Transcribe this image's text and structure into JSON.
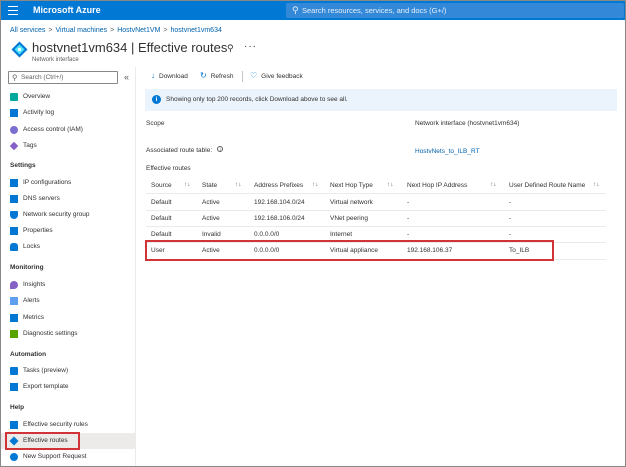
{
  "topbar": {
    "brand": "Microsoft Azure",
    "search_placeholder": "Search resources, services, and docs (G+/)"
  },
  "breadcrumb": [
    "All services",
    "Virtual machines",
    "HostvNet1VM",
    "hostvnet1vm634"
  ],
  "header": {
    "title": "hostvnet1vm634 | Effective routes",
    "subtitle": "Network interface"
  },
  "sidebar": {
    "search_placeholder": "Search (Ctrl+/)",
    "top_items": [
      {
        "label": "Overview",
        "icon": "overview-icon"
      },
      {
        "label": "Activity log",
        "icon": "activity-log-icon"
      },
      {
        "label": "Access control (IAM)",
        "icon": "iam-icon"
      },
      {
        "label": "Tags",
        "icon": "tag-icon"
      }
    ],
    "sections": [
      {
        "title": "Settings",
        "items": [
          {
            "label": "IP configurations",
            "icon": "ip-config-icon"
          },
          {
            "label": "DNS servers",
            "icon": "dns-icon"
          },
          {
            "label": "Network security group",
            "icon": "shield-icon"
          },
          {
            "label": "Properties",
            "icon": "properties-icon"
          },
          {
            "label": "Locks",
            "icon": "lock-icon"
          }
        ]
      },
      {
        "title": "Monitoring",
        "items": [
          {
            "label": "Insights",
            "icon": "insights-icon"
          },
          {
            "label": "Alerts",
            "icon": "alerts-icon"
          },
          {
            "label": "Metrics",
            "icon": "metrics-icon"
          },
          {
            "label": "Diagnostic settings",
            "icon": "diagnostic-icon"
          }
        ]
      },
      {
        "title": "Automation",
        "items": [
          {
            "label": "Tasks (preview)",
            "icon": "tasks-icon"
          },
          {
            "label": "Export template",
            "icon": "export-icon"
          }
        ]
      },
      {
        "title": "Help",
        "items": [
          {
            "label": "Effective security rules",
            "icon": "security-rules-icon"
          },
          {
            "label": "Effective routes",
            "icon": "routes-icon"
          },
          {
            "label": "New Support Request",
            "icon": "support-icon"
          }
        ]
      }
    ]
  },
  "toolbar": {
    "download": "Download",
    "refresh": "Refresh",
    "feedback": "Give feedback"
  },
  "info": {
    "text": "Showing only top 200 records, click Download above to see all."
  },
  "details": {
    "scope_label": "Scope",
    "scope_value": "Network interface (hostvnet1vm634)",
    "route_table_label": "Associated route table:",
    "route_table_value": "HostvNets_to_ILB_RT",
    "effective_routes_heading": "Effective routes"
  },
  "table": {
    "columns": [
      "Source",
      "State",
      "Address Prefixes",
      "Next Hop Type",
      "Next Hop IP Address",
      "User Defined Route Name"
    ],
    "rows": [
      [
        "Default",
        "Active",
        "192.168.104.0/24",
        "Virtual network",
        "-",
        "-"
      ],
      [
        "Default",
        "Active",
        "192.168.106.0/24",
        "VNet peering",
        "-",
        "-"
      ],
      [
        "Default",
        "Invalid",
        "0.0.0.0/0",
        "Internet",
        "-",
        "-"
      ],
      [
        "User",
        "Active",
        "0.0.0.0/0",
        "Virtual appliance",
        "192.168.106.37",
        "To_ILB"
      ]
    ]
  },
  "colors": {
    "accent": "#0078d4",
    "highlight": "#d13438"
  }
}
